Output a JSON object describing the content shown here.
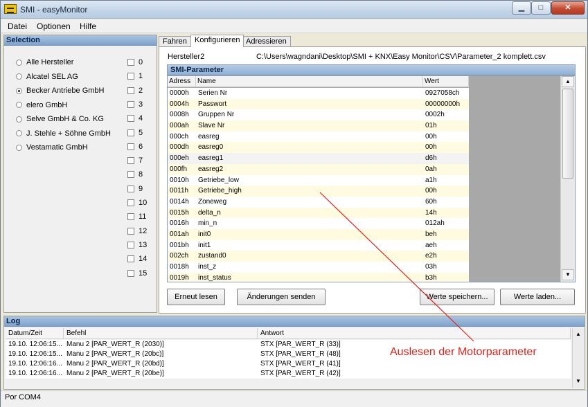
{
  "window": {
    "title": "SMI - easyMonitor",
    "min_symbol": "▁",
    "max_symbol": "□",
    "close_symbol": "✕"
  },
  "menu": [
    "Datei",
    "Optionen",
    "Hilfe"
  ],
  "selection": {
    "title": "Selection",
    "manufacturers": [
      {
        "label": "Alle Hersteller",
        "selected": false
      },
      {
        "label": "Alcatel SEL AG",
        "selected": false
      },
      {
        "label": "Becker Antriebe GmbH",
        "selected": true
      },
      {
        "label": "elero GmbH",
        "selected": false
      },
      {
        "label": "Selve GmbH & Co. KG",
        "selected": false
      },
      {
        "label": "J. Stehle + Söhne GmbH",
        "selected": false
      },
      {
        "label": "Vestamatic GmbH",
        "selected": false
      }
    ],
    "checks": [
      "0",
      "1",
      "2",
      "3",
      "4",
      "5",
      "6",
      "7",
      "8",
      "9",
      "10",
      "11",
      "12",
      "13",
      "14",
      "15"
    ]
  },
  "tabs": [
    "Fahren",
    "Konfigurieren",
    "Adressieren"
  ],
  "config": {
    "hersteller_label": "Hersteller2",
    "path": "C:\\Users\\wagndani\\Desktop\\SMI + KNX\\Easy Monitor\\CSV\\Parameter_2 komplett.csv",
    "grid_title": "SMI-Parameter",
    "columns": [
      "Adress",
      "Name",
      "Wert"
    ],
    "rows": [
      [
        "0000h",
        "Serien Nr",
        "0927058ch"
      ],
      [
        "0004h",
        "Passwort",
        "00000000h"
      ],
      [
        "0008h",
        "Gruppen Nr",
        "0002h"
      ],
      [
        "000ah",
        "Slave Nr",
        "01h"
      ],
      [
        "000ch",
        "easreg",
        "00h"
      ],
      [
        "000dh",
        "easreg0",
        "00h"
      ],
      [
        "000eh",
        "easreg1",
        "d6h"
      ],
      [
        "000fh",
        "easreg2",
        "0ah"
      ],
      [
        "0010h",
        "Getriebe_low",
        "a1h"
      ],
      [
        "0011h",
        "Getriebe_high",
        "00h"
      ],
      [
        "0014h",
        "Zoneweg",
        "60h"
      ],
      [
        "0015h",
        "delta_n",
        "14h"
      ],
      [
        "0016h",
        "min_n",
        "012ah"
      ],
      [
        "001ah",
        "init0",
        "beh"
      ],
      [
        "001bh",
        "init1",
        "aeh"
      ],
      [
        "002ch",
        "zustand0",
        "e2h"
      ],
      [
        "0018h",
        "inst_z",
        "03h"
      ],
      [
        "0019h",
        "inst_status",
        "b3h"
      ]
    ],
    "buttons": {
      "reread": "Erneut lesen",
      "send": "Änderungen senden",
      "save": "Werte speichern...",
      "load": "Werte laden..."
    }
  },
  "log": {
    "title": "Log",
    "columns": [
      "Datum/Zeit",
      "Befehl",
      "Antwort"
    ],
    "rows": [
      [
        "19.10. 12:06:15...",
        "Manu 2 [PAR_WERT_R (2030)]",
        "STX [PAR_WERT_R (33)]"
      ],
      [
        "19.10. 12:06:15...",
        "Manu 2 [PAR_WERT_R (20bc)]",
        "STX [PAR_WERT_R (48)]"
      ],
      [
        "19.10. 12:06:16...",
        "Manu 2 [PAR_WERT_R (20bd)]",
        "STX [PAR_WERT_R (41)]"
      ],
      [
        "19.10. 12:06:16...",
        "Manu 2 [PAR_WERT_R (20be)]",
        "STX [PAR_WERT_R (42)]"
      ]
    ]
  },
  "status": "Por COM4",
  "annotation": {
    "text": "Auslesen der Motorparameter",
    "color": "#e0221b"
  },
  "icons": {
    "up": "▲",
    "down": "▼"
  }
}
